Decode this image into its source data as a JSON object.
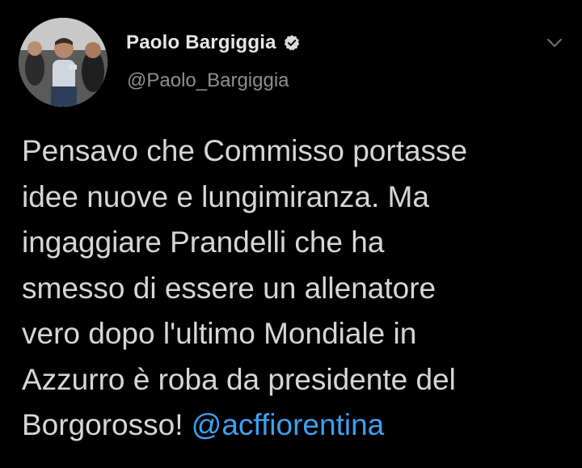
{
  "tweet": {
    "author": {
      "display_name": "Paolo Bargiggia",
      "handle": "@Paolo_Bargiggia",
      "verified": true,
      "avatar": "profile-photo"
    },
    "menu_icon": "chevron-down-icon",
    "text_lines": [
      "Pensavo che Commisso portasse",
      "idee nuove e lungimiranza. Ma",
      "ingaggiare Prandelli che ha",
      "smesso di essere un allenatore",
      "vero dopo l'ultimo Mondiale in",
      "Azzurro è roba da presidente del",
      "Borgorosso!"
    ],
    "mention": "@acffiorentina"
  },
  "colors": {
    "background": "#000000",
    "text": "#d6d6d6",
    "handle": "#8e8e8e",
    "link": "#3ba1f2"
  }
}
